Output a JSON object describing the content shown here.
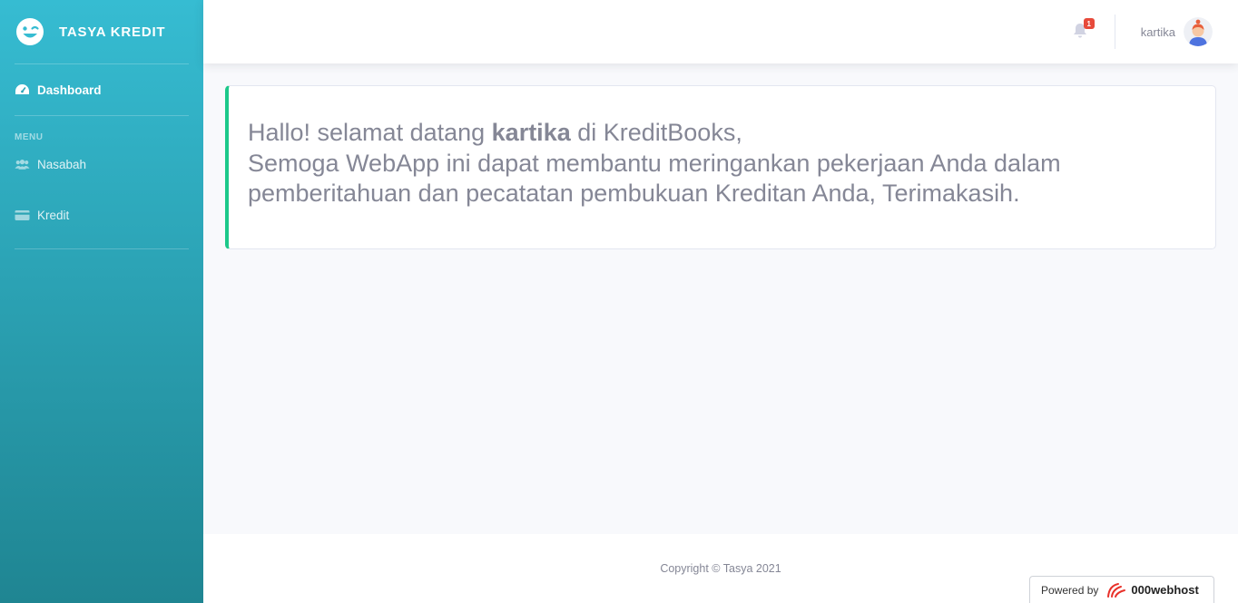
{
  "brand": {
    "name": "TASYA KREDIT",
    "icon": "wink-face-icon"
  },
  "sidebar": {
    "dashboard": {
      "label": "Dashboard",
      "icon": "tachometer-icon"
    },
    "menu_heading": "MENU",
    "items": [
      {
        "label": "Nasabah",
        "icon": "users-icon"
      },
      {
        "label": "Kredit",
        "icon": "credit-card-icon"
      }
    ]
  },
  "topbar": {
    "notifications": {
      "icon": "bell-icon",
      "count": "1"
    },
    "user_name": "kartika",
    "avatar_icon": "user-avatar-icon"
  },
  "welcome": {
    "prefix": "Hallo! selamat datang ",
    "user": "kartika",
    "suffix": " di KreditBooks,",
    "line2": "Semoga WebApp ini dapat membantu meringankan pekerjaan Anda dalam",
    "line3": "pemberitahuan dan pecatatan pembukuan Kreditan Anda, Terimakasih."
  },
  "footer": {
    "copyright": "Copyright © Tasya 2021"
  },
  "powered_badge": {
    "label": "Powered by",
    "host": "000webhost"
  },
  "colors": {
    "sidebar_top": "#36bcd2",
    "sidebar_bottom": "#1f8592",
    "card_accent": "#1cc88a",
    "badge": "#e74a3b",
    "text_muted": "#858796"
  }
}
